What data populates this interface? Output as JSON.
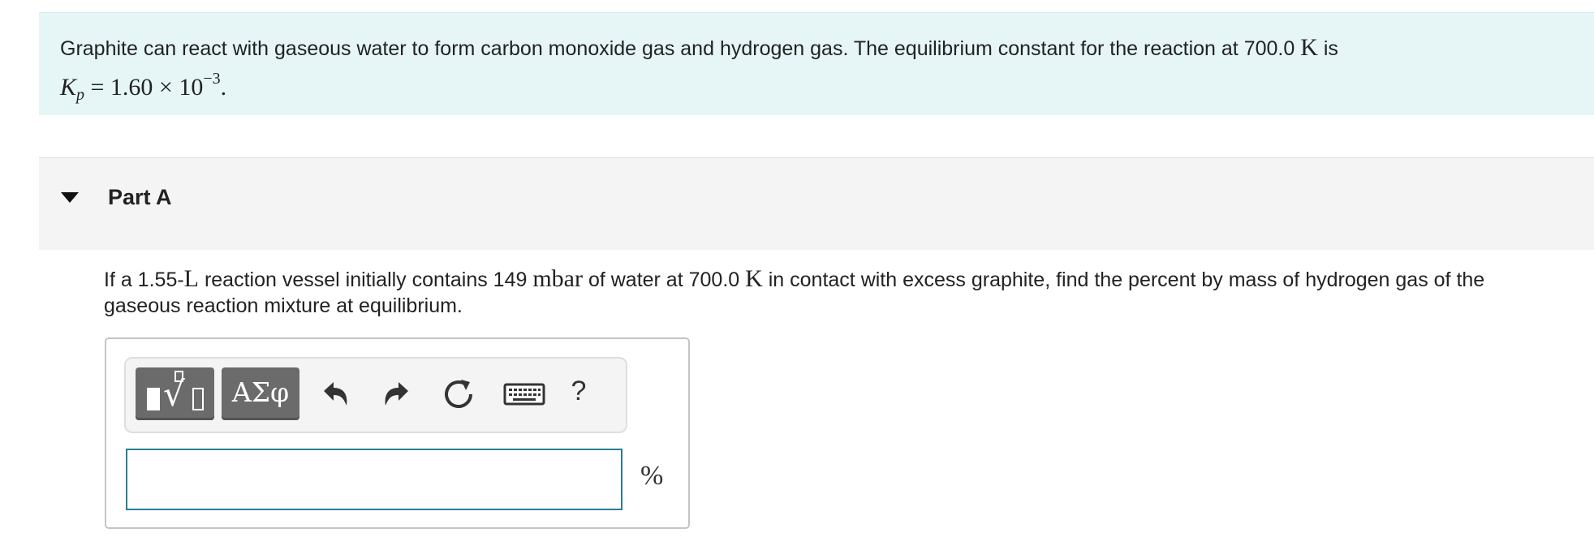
{
  "intro": {
    "text_before_temp": "Graphite can react with gaseous water to form carbon monoxide gas and hydrogen gas. The equilibrium constant for the reaction at 700.0",
    "temp_unit": "K",
    "text_after_temp": "is",
    "kp_symbol": "K",
    "kp_subscript": "p",
    "kp_equals": "= 1.60 × 10",
    "kp_exponent": "−3",
    "kp_end": "."
  },
  "part_a": {
    "title": "Part A",
    "question": {
      "t1": "If a 1.55-",
      "u1": "L",
      "t2": "reaction vessel initially contains 149",
      "u2": "mbar",
      "t3": "of water at 700.0",
      "u3": "K",
      "t4": "in contact with excess graphite, find the percent by mass of hydrogen gas of the gaseous reaction mixture at equilibrium."
    },
    "toolbar": {
      "greek_label": "ΑΣφ",
      "help_label": "?"
    },
    "answer": {
      "value": "",
      "unit": "%"
    }
  },
  "colors": {
    "intro_bg": "#e6f6f6",
    "header_bg": "#f4f4f4",
    "input_border": "#2a7c95",
    "tool_button": "#6b6b6b"
  },
  "icons": [
    "caret-down-icon",
    "templates-icon",
    "undo-icon",
    "redo-icon",
    "reset-icon",
    "keyboard-icon",
    "help-icon"
  ]
}
